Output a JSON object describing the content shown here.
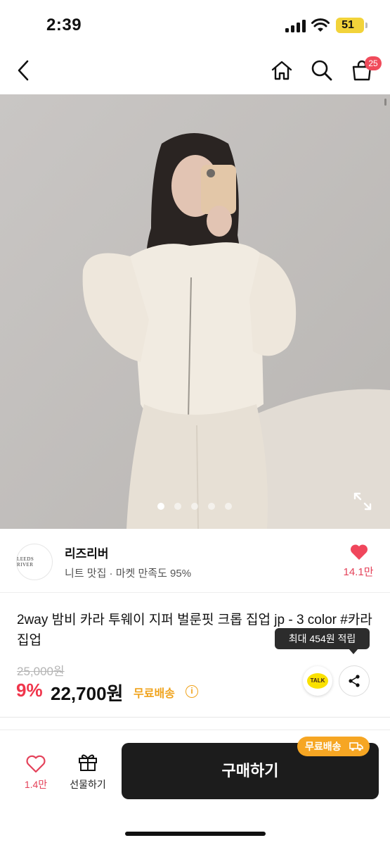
{
  "status_bar": {
    "time": "2:39",
    "battery": "51"
  },
  "nav": {
    "cart_count": "25",
    "icons": [
      "back-icon",
      "home-icon",
      "search-icon",
      "cart-icon"
    ]
  },
  "gallery": {
    "page_count": 5,
    "active_index": 0,
    "expand_icon": "expand-icon"
  },
  "seller": {
    "logo_text": "LEEDS RIVER",
    "name": "리즈리버",
    "description": "니트 맛집 · 마켓 만족도 95%",
    "likes": "14.1만"
  },
  "product": {
    "title": "2way 밤비 카라 투웨이 지퍼 벌룬핏 크롭 집업 jp - 3 color #카라집업",
    "points_tooltip": "최대 454원 적립",
    "original_price": "25,000원",
    "discount": "9%",
    "price": "22,700원",
    "shipping": "무료배송",
    "talk_label": "TALK"
  },
  "bottom_bar": {
    "like_count": "1.4만",
    "gift_label": "선물하기",
    "buy_label": "구매하기",
    "free_ship_pill": "무료배송"
  },
  "colors": {
    "accent_red": "#f0364c",
    "shipping_orange": "#f0a31c",
    "buy_button": "#1c1c1c"
  }
}
